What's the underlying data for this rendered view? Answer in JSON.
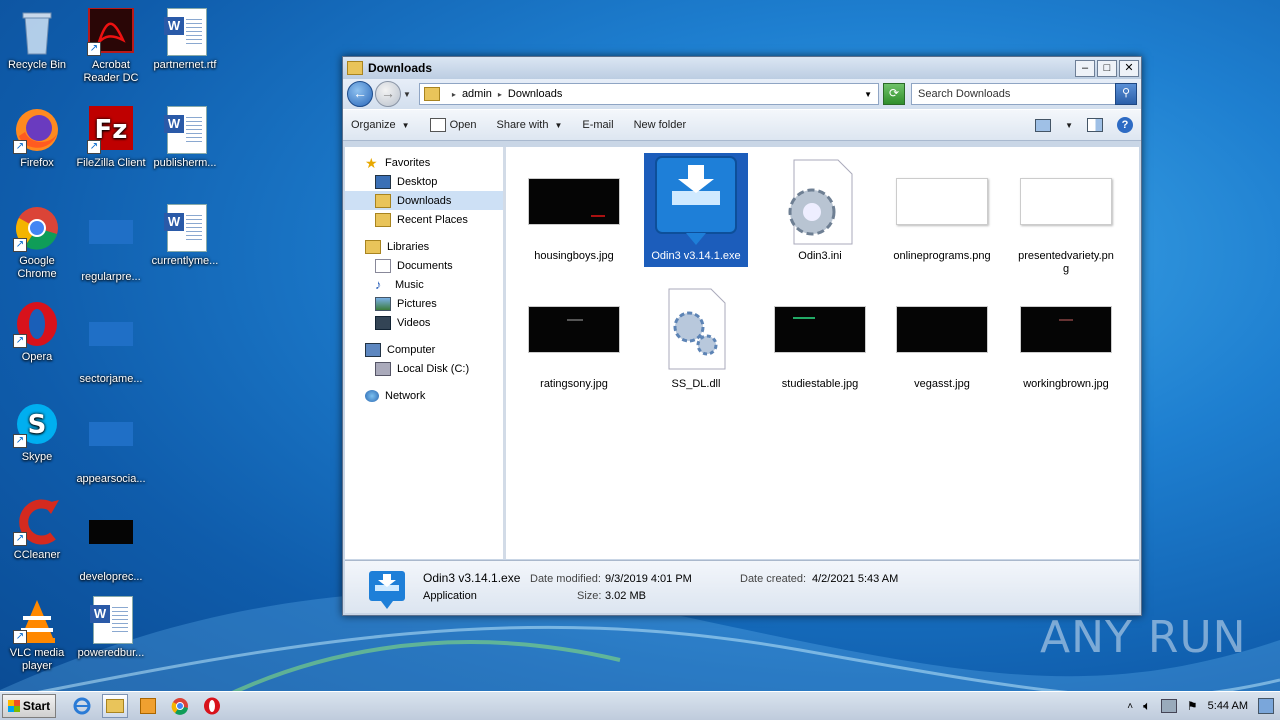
{
  "desktop": {
    "icons": [
      {
        "label": "Recycle Bin"
      },
      {
        "label": "Acrobat Reader DC"
      },
      {
        "label": "partnernet.rtf"
      },
      {
        "label": "Firefox"
      },
      {
        "label": "FileZilla Client"
      },
      {
        "label": "publisherm..."
      },
      {
        "label": "Google Chrome"
      },
      {
        "label": "regularpre..."
      },
      {
        "label": "currentlyme..."
      },
      {
        "label": "Opera"
      },
      {
        "label": "sectorjame..."
      },
      {
        "label": "Skype"
      },
      {
        "label": "appearsocia..."
      },
      {
        "label": "CCleaner"
      },
      {
        "label": "developrec..."
      },
      {
        "label": "VLC media player"
      },
      {
        "label": "poweredbur..."
      }
    ]
  },
  "window": {
    "title": "Downloads",
    "address": {
      "segment1": "admin",
      "segment2": "Downloads"
    },
    "search_placeholder": "Search Downloads",
    "toolbar": {
      "organize": "Organize",
      "open": "Open",
      "share_with": "Share with",
      "email": "E-mail",
      "new_folder": "New folder"
    },
    "nav": {
      "favorites": "Favorites",
      "desktop": "Desktop",
      "downloads": "Downloads",
      "recent_places": "Recent Places",
      "libraries": "Libraries",
      "documents": "Documents",
      "music": "Music",
      "pictures": "Pictures",
      "videos": "Videos",
      "computer": "Computer",
      "local_disk": "Local Disk (C:)",
      "network": "Network"
    },
    "files": [
      {
        "name": "housingboys.jpg"
      },
      {
        "name": "Odin3 v3.14.1.exe"
      },
      {
        "name": "Odin3.ini"
      },
      {
        "name": "onlineprograms.png"
      },
      {
        "name": "presentedvariety.png"
      },
      {
        "name": "ratingsony.jpg"
      },
      {
        "name": "SS_DL.dll"
      },
      {
        "name": "studiestable.jpg"
      },
      {
        "name": "vegasst.jpg"
      },
      {
        "name": "workingbrown.jpg"
      }
    ],
    "details": {
      "name": "Odin3 v3.14.1.exe",
      "type": "Application",
      "modified_label": "Date modified:",
      "modified_value": "9/3/2019 4:01 PM",
      "size_label": "Size:",
      "size_value": "3.02 MB",
      "created_label": "Date created:",
      "created_value": "4/2/2021 5:43 AM"
    }
  },
  "taskbar": {
    "start_label": "Start",
    "clock": "5:44 AM"
  },
  "watermark": "ANY RUN"
}
